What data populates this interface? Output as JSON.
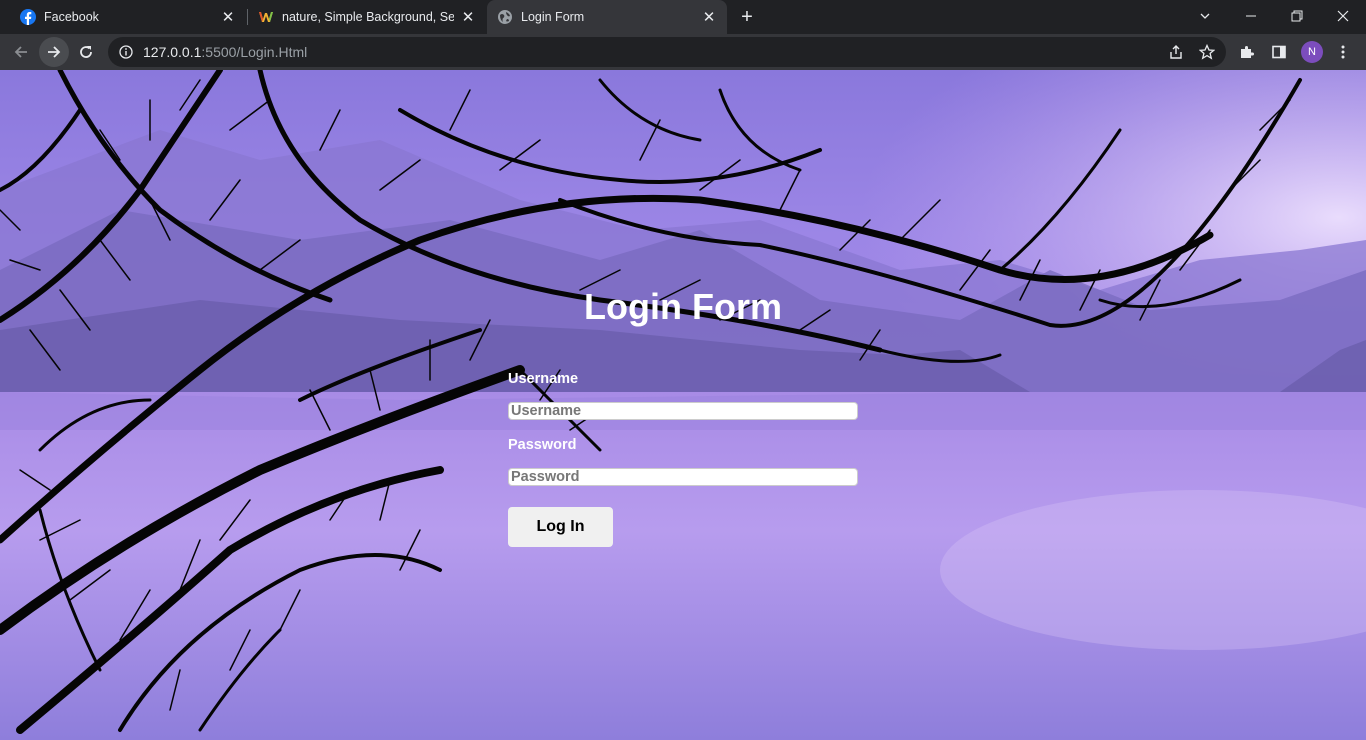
{
  "browser": {
    "tabs": [
      {
        "title": "Facebook",
        "icon": "facebook-icon"
      },
      {
        "title": "nature, Simple Background, Sea W",
        "icon": "wallhaven-icon"
      },
      {
        "title": "Login Form",
        "icon": "globe-icon",
        "active": true
      }
    ],
    "url_host": "127.0.0.1",
    "url_rest": ":5500/Login.Html",
    "profile_initial": "N"
  },
  "page": {
    "title": "Login Form",
    "username_label": "Username",
    "username_placeholder": "Username",
    "password_label": "Password",
    "password_placeholder": "Password",
    "login_button": "Log In"
  },
  "colors": {
    "sky": "#9c86e6",
    "accent": "#7c4dbd"
  }
}
